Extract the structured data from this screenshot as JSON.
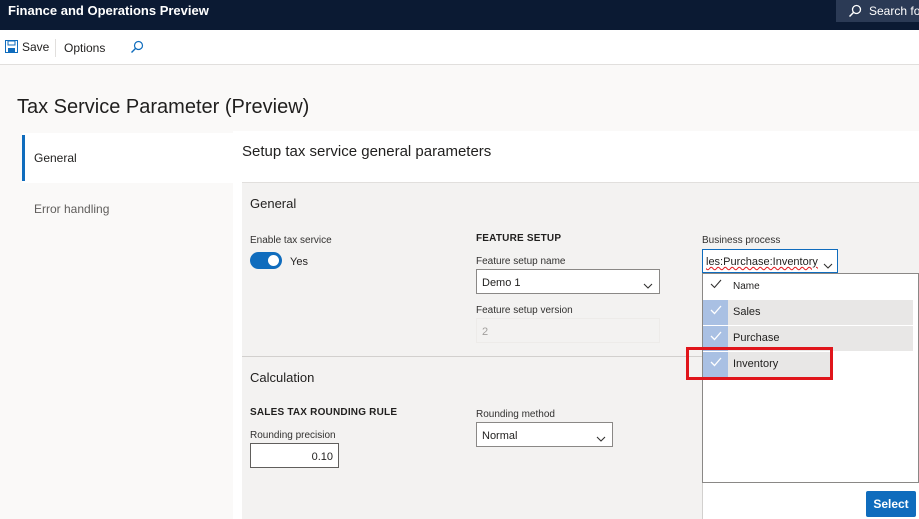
{
  "app": {
    "title": "Finance and Operations Preview",
    "search_label": "Search fo"
  },
  "actionbar": {
    "save_label": "Save",
    "options_label": "Options"
  },
  "page": {
    "title": "Tax Service Parameter (Preview)"
  },
  "nav": {
    "items": [
      {
        "label": "General",
        "active": true
      },
      {
        "label": "Error handling",
        "active": false
      }
    ]
  },
  "main": {
    "heading": "Setup tax service general parameters",
    "general": {
      "title": "General",
      "enable_label": "Enable tax service",
      "enable_value": "Yes",
      "feature_caption": "FEATURE SETUP",
      "feature_name_label": "Feature setup name",
      "feature_name_value": "Demo 1",
      "feature_version_label": "Feature setup version",
      "feature_version_value": "2"
    },
    "calculation": {
      "title": "Calculation",
      "rounding_caption": "SALES TAX ROUNDING RULE",
      "precision_label": "Rounding precision",
      "precision_value": "0.10",
      "method_label": "Rounding method",
      "method_value": "Normal"
    },
    "business_process": {
      "label": "Business process",
      "value": "les:Purchase:Inventory",
      "column_header": "Name",
      "options": [
        {
          "name": "Sales",
          "checked": true
        },
        {
          "name": "Purchase",
          "checked": true
        },
        {
          "name": "Inventory",
          "checked": true
        }
      ],
      "select_label": "Select"
    }
  },
  "colors": {
    "accent": "#0f6cbd",
    "topbar": "#0b1a33",
    "highlight": "#e0151b"
  }
}
